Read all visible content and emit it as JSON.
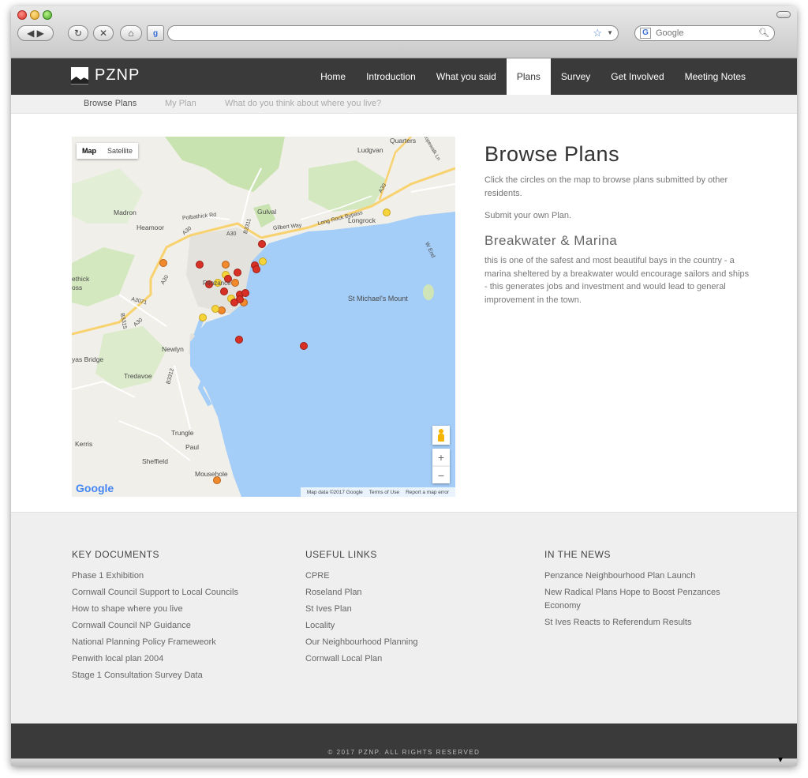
{
  "browser": {
    "search_placeholder": "Google",
    "address_value": "",
    "back_icon": "back-arrow-icon",
    "forward_icon": "forward-arrow-icon",
    "reload_icon": "reload-icon",
    "stop_icon": "stop-icon",
    "home_icon": "home-icon"
  },
  "site": {
    "logo": "PZNP",
    "nav": [
      "Home",
      "Introduction",
      "What you said",
      "Plans",
      "Survey",
      "Get Involved",
      "Meeting Notes"
    ],
    "active_nav": "Plans",
    "subnav": [
      "Browse Plans",
      "My Plan",
      "What do you think about where you live?"
    ]
  },
  "map": {
    "type_map": "Map",
    "type_satellite": "Satellite",
    "zoom_in": "+",
    "zoom_out": "−",
    "attribution": [
      "Map data ©2017 Google",
      "Terms of Use",
      "Report a map error"
    ],
    "google": "Google",
    "labels": {
      "quarters": "Quarters",
      "ludgvan": "Ludgvan",
      "gulval": "Gulval",
      "madron": "Madron",
      "heamoor": "Heamoor",
      "longrock": "Longrock",
      "long_rock_bypass": "Long Rock Bypass",
      "a30_a": "A30",
      "a30_b": "A30",
      "a30_c": "A30",
      "a30_d": "A30",
      "a30_e": "A30",
      "b3311": "B3311",
      "b3312": "B3312",
      "a3071": "A3071",
      "b3315": "B3315",
      "polbathick": "Polbathick",
      "pen": "Penzance",
      "st_michaels": "St Michael's Mount",
      "newlyn": "Newlyn",
      "tredavoe": "Tredavoe",
      "bridge": "yas Bridge",
      "trungle": "Trungle",
      "paul": "Paul",
      "kerris": "Kerris",
      "sheffield": "Sheffield",
      "mousehole": "Mousehole",
      "ethick": "ethick",
      "oss": "oss",
      "polbathick_rd": "Polbathick Rd",
      "gilbert_way": "Gilbert Way",
      "w_end": "W End",
      "ropewalk": "Ropewalk Ln"
    }
  },
  "main": {
    "title": "Browse Plans",
    "intro": "Click the circles on the map to browse plans submitted by other residents.",
    "submit": "Submit your own Plan.",
    "plan_title": "Breakwater & Marina",
    "plan_body": "this is one of the safest and most beautiful bays in the country - a marina sheltered by a breakwater would encourage sailors and ships - this generates jobs and investment and would lead to general improvement in the town."
  },
  "footer": {
    "key_documents": {
      "heading": "KEY DOCUMENTS",
      "links": [
        "Phase 1 Exhibition",
        "Cornwall Council Support to Local Councils",
        "How to shape where you live",
        "Cornwall Council NP Guidance",
        "National Planning Policy Frameweork",
        "Penwith local plan 2004",
        "Stage 1 Consultation Survey Data"
      ]
    },
    "useful_links": {
      "heading": "USEFUL LINKS",
      "links": [
        "CPRE",
        "Roseland Plan",
        "St Ives Plan",
        "Locality",
        "Our Neighbourhood Planning",
        "Cornwall Local Plan"
      ]
    },
    "in_the_news": {
      "heading": "IN THE NEWS",
      "links": [
        "Penzance Neighbourhood Plan Launch",
        "New Radical Plans Hope to Boost Penzances Economy",
        "St Ives Reacts to Referendum Results"
      ]
    },
    "copyright": "© 2017 PZNP. ALL RIGHTS RESERVED"
  },
  "colors": {
    "nav_bg": "#3a3a3a",
    "sea": "#a4cdf8",
    "pin_red": "#d93025",
    "pin_orange": "#f08a2c",
    "pin_yellow": "#f5d33a"
  }
}
